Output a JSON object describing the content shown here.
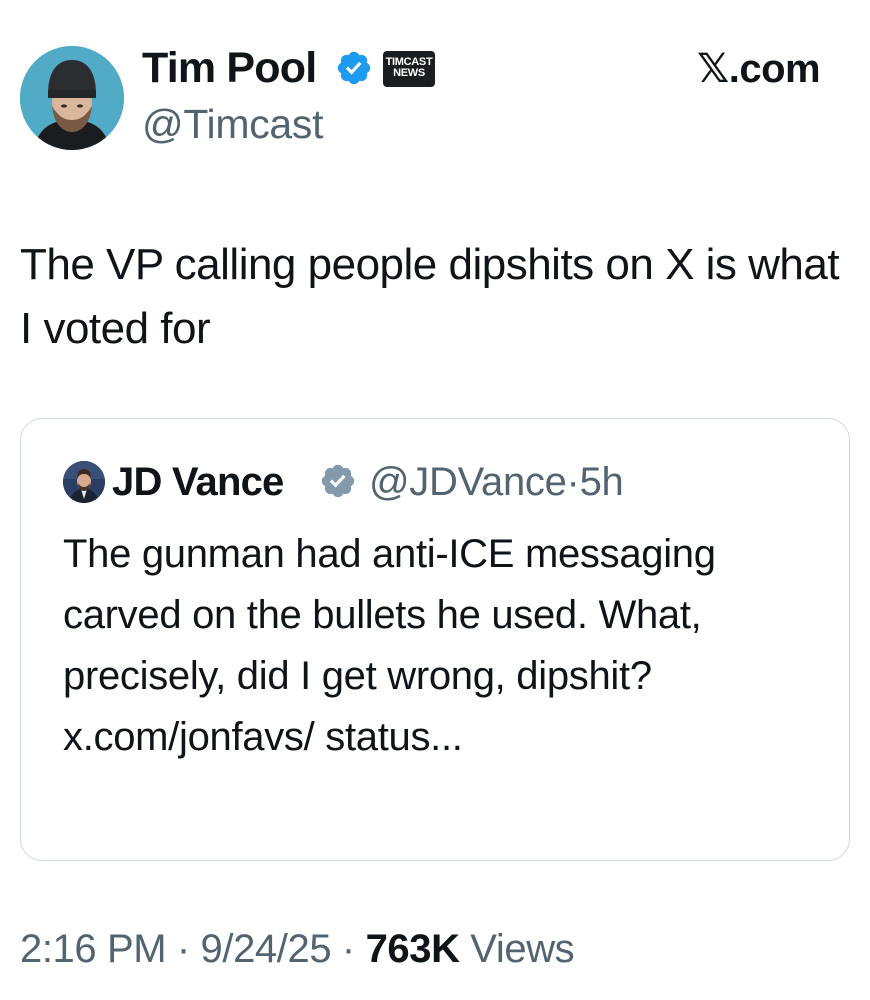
{
  "author": {
    "display_name": "Tim Pool",
    "handle": "@Timcast",
    "org_badge_line1": "TIMCAST",
    "org_badge_line2": "NEWS",
    "avatar_icon": "profile-photo",
    "verified_icon": "verified-badge-icon"
  },
  "site_logo": "𝕏.com",
  "tweet_text": "The VP calling people dipshits on X is what I voted for",
  "quoted_tweet": {
    "display_name": "JD Vance",
    "handle": "@JDVance",
    "separator": "·",
    "time_ago": "5h",
    "text": "The gunman had anti-ICE messaging carved on the bullets he used. What, precisely, did I get wrong, dipshit? x.com/jonfavs/ status...",
    "avatar_icon": "profile-photo",
    "verified_icon": "verified-badge-icon"
  },
  "meta": {
    "time": "2:16 PM",
    "sep1": " · ",
    "date": "9/24/25",
    "sep2": " · ",
    "views_count": "763K",
    "views_label": " Views"
  },
  "colors": {
    "text_primary": "#0f1419",
    "text_secondary": "#536471",
    "verified_blue": "#1d9bf0",
    "verified_gray": "#829aab",
    "card_border": "#cfd9de"
  }
}
